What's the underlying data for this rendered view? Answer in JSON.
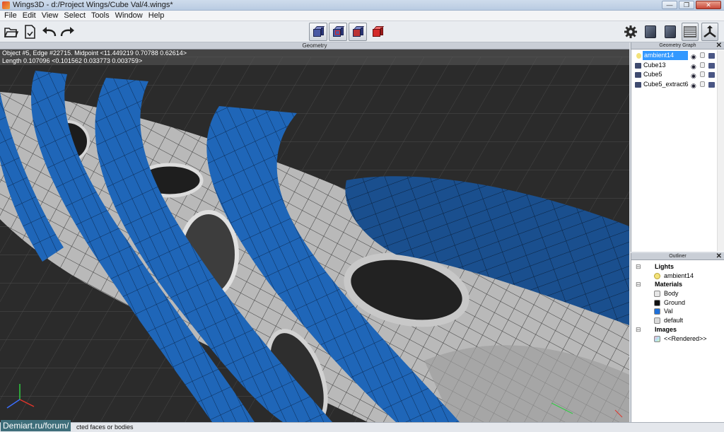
{
  "window": {
    "title": "Wings3D - d:/Project Wings/Cube Val/4.wings*",
    "buttons": {
      "minimize": "—",
      "maximize": "❐",
      "close": "✕"
    }
  },
  "menu": [
    "File",
    "Edit",
    "View",
    "Select",
    "Tools",
    "Window",
    "Help"
  ],
  "toolbar": {
    "left_icons": [
      "open-icon",
      "save-icon",
      "undo-icon",
      "redo-icon"
    ],
    "selection_modes": [
      "vertex-mode",
      "edge-mode",
      "face-mode",
      "body-mode"
    ],
    "right_icons": [
      "gear-icon",
      "smooth-view-icon",
      "flat-view-icon",
      "groundplane-icon",
      "axes-icon"
    ]
  },
  "viewport": {
    "header": "Geometry",
    "info_line1": "Object #5, Edge #22715. Midpoint <11.449219  0.70788  0.62614>",
    "info_line2": "Length 0.107096  <0.101562  0.033773  0.003759>"
  },
  "geometry_graph": {
    "header": "Geometry Graph",
    "close": "✕",
    "items": [
      {
        "name": "ambient14",
        "selected": true,
        "kind": "light"
      },
      {
        "name": "Cube13",
        "selected": false,
        "kind": "object"
      },
      {
        "name": "Cube5",
        "selected": false,
        "kind": "object"
      },
      {
        "name": "Cube5_extract6",
        "selected": false,
        "kind": "object"
      }
    ]
  },
  "outliner": {
    "header": "Outliner",
    "close": "✕",
    "lights_label": "Lights",
    "lights": [
      "ambient14"
    ],
    "materials_label": "Materials",
    "materials": [
      {
        "name": "Body",
        "color": "#e6e6e6"
      },
      {
        "name": "Ground",
        "color": "#111111"
      },
      {
        "name": "Val",
        "color": "#1e6fd8"
      },
      {
        "name": "default",
        "color": "#d9d9d9"
      }
    ],
    "images_label": "Images",
    "images": [
      "<<Rendered>>"
    ]
  },
  "status": {
    "text": "cted faces or bodies",
    "watermark": "Demiart.ru/forum/"
  },
  "colors": {
    "tube_blue": "#1f66b8",
    "body_gray": "#b8b8b8",
    "background": "#2b2b2b"
  }
}
